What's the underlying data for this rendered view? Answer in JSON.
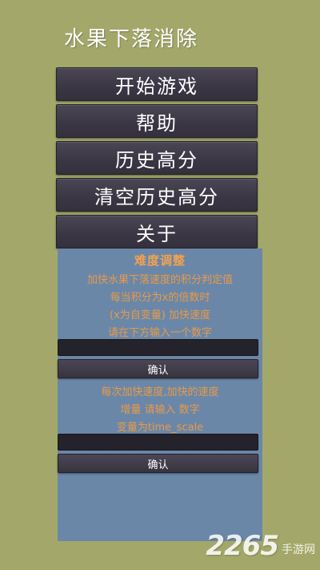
{
  "title": "水果下落消除",
  "menu": [
    {
      "label": "开始游戏"
    },
    {
      "label": "帮助"
    },
    {
      "label": "历史高分"
    },
    {
      "label": "清空历史高分"
    },
    {
      "label": "关于"
    }
  ],
  "difficulty": {
    "heading": "难度调整",
    "line1": "加快水果下落速度的积分判定值",
    "line2": "每当积分为x的倍数时",
    "line3": "(x为自变量) 加快速度",
    "line4": "请在下方输入一个数字",
    "input1_value": "",
    "confirm1_label": "确认",
    "line5": "每次加快速度,加快的速度",
    "line6": "增量 请输入 数字",
    "line7": "变量为time_scale",
    "input2_value": "",
    "confirm2_label": "确认"
  },
  "watermark": {
    "number": "2265",
    "text": "手游网"
  },
  "colors": {
    "background": "#a3a86a",
    "button": "#3a3644",
    "panel": "#6b87a8",
    "panel_text": "#e79a48"
  }
}
